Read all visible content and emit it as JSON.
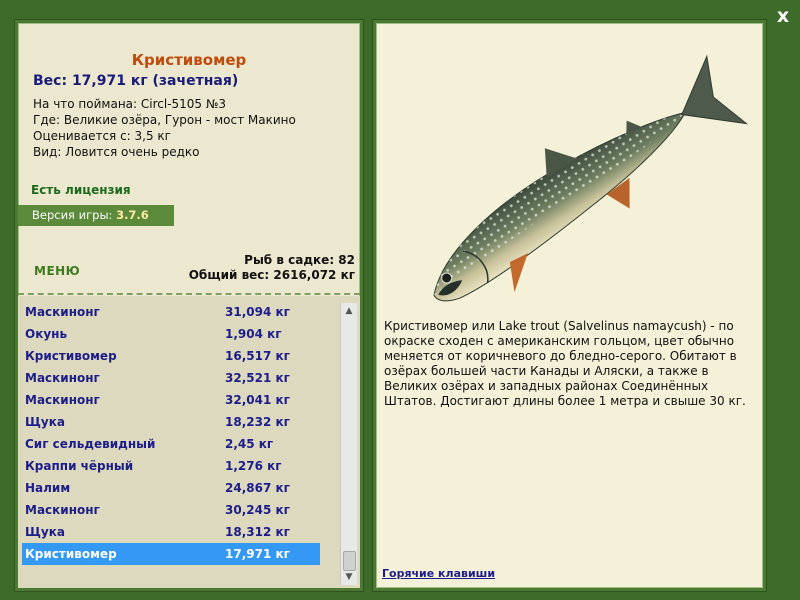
{
  "window": {
    "close_label": "x"
  },
  "fish": {
    "name": "Кристивомер",
    "weight_line": "Вес: 17,971 кг (зачетная)",
    "caught_with": "На что поймана: Circl-5105 №3",
    "location": "Где: Великие озёра, Гурон - мост Макино",
    "rated_from": "Оценивается с: 3,5 кг",
    "rarity": "Вид: Ловится очень редко"
  },
  "license": "Есть лицензия",
  "version": {
    "label": "Версия игры:",
    "value": "3.7.6"
  },
  "menu_label": "МЕНЮ",
  "cage": {
    "count": "Рыб в садке: 82",
    "total_weight": "Общий вес: 2616,072 кг"
  },
  "catch_list": [
    {
      "name": "Маскинонг",
      "weight": "31,094 кг"
    },
    {
      "name": "Окунь",
      "weight": "1,904 кг"
    },
    {
      "name": "Кристивомер",
      "weight": "16,517 кг"
    },
    {
      "name": "Маскинонг",
      "weight": "32,521 кг"
    },
    {
      "name": "Маскинонг",
      "weight": "32,041 кг"
    },
    {
      "name": "Щука",
      "weight": "18,232 кг"
    },
    {
      "name": "Сиг сельдевидный",
      "weight": "2,45 кг"
    },
    {
      "name": "Краппи чёрный",
      "weight": "1,276 кг"
    },
    {
      "name": "Налим",
      "weight": "24,867 кг"
    },
    {
      "name": "Маскинонг",
      "weight": "30,245 кг"
    },
    {
      "name": "Щука",
      "weight": "18,312 кг"
    },
    {
      "name": "Кристивомер",
      "weight": "17,971 кг",
      "selected": true
    }
  ],
  "description": "Кристивомер или Lake trout (Salvelinus namaycush) - по окраске сходен с американским гольцом, цвет обычно меняется от коричневого до бледно-серого. Обитают в озёрах большей части Канады и Аляски, а также в Великих озёрах и западных районах Соединённых Штатов. Достигают длины более 1 метра и свыше 30 кг.",
  "hotkeys_label": "Горячие клавиши",
  "icons": {
    "close": "close-icon",
    "scroll_up": "arrow-up-icon",
    "scroll_down": "arrow-down-icon",
    "fish_image": "lake-trout-image"
  },
  "colors": {
    "background": "#3d6b2a",
    "title": "#c24a0b",
    "list_text": "#1d1d8a",
    "selection": "#3399f5",
    "license": "#1d6a1d"
  }
}
